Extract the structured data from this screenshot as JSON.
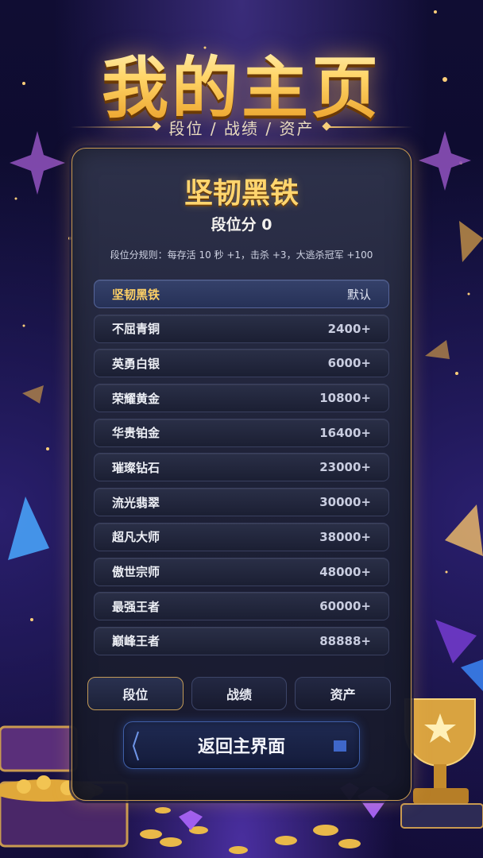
{
  "header": {
    "title": "我的主页",
    "subtitle": "段位 / 战绩 / 资产"
  },
  "rank": {
    "current_name": "坚韧黑铁",
    "score_label": "段位分 0",
    "rule_text": "段位分规则：每存活 10 秒 +1，击杀 +3，大逃杀冠军 +100"
  },
  "tiers": [
    {
      "name": "坚韧黑铁",
      "threshold": "默认"
    },
    {
      "name": "不屈青铜",
      "threshold": "2400+"
    },
    {
      "name": "英勇白银",
      "threshold": "6000+"
    },
    {
      "name": "荣耀黄金",
      "threshold": "10800+"
    },
    {
      "name": "华贵铂金",
      "threshold": "16400+"
    },
    {
      "name": "璀璨钻石",
      "threshold": "23000+"
    },
    {
      "name": "流光翡翠",
      "threshold": "30000+"
    },
    {
      "name": "超凡大师",
      "threshold": "38000+"
    },
    {
      "name": "傲世宗师",
      "threshold": "48000+"
    },
    {
      "name": "最强王者",
      "threshold": "60000+"
    },
    {
      "name": "巅峰王者",
      "threshold": "88888+"
    }
  ],
  "tabs": [
    {
      "label": "段位",
      "active": true
    },
    {
      "label": "战绩",
      "active": false
    },
    {
      "label": "资产",
      "active": false
    }
  ],
  "back_button": {
    "label": "返回主界面"
  },
  "colors": {
    "gold": "#ffd56e",
    "panel_border": "#c99a50",
    "button_blue": "#3f5fa8"
  }
}
